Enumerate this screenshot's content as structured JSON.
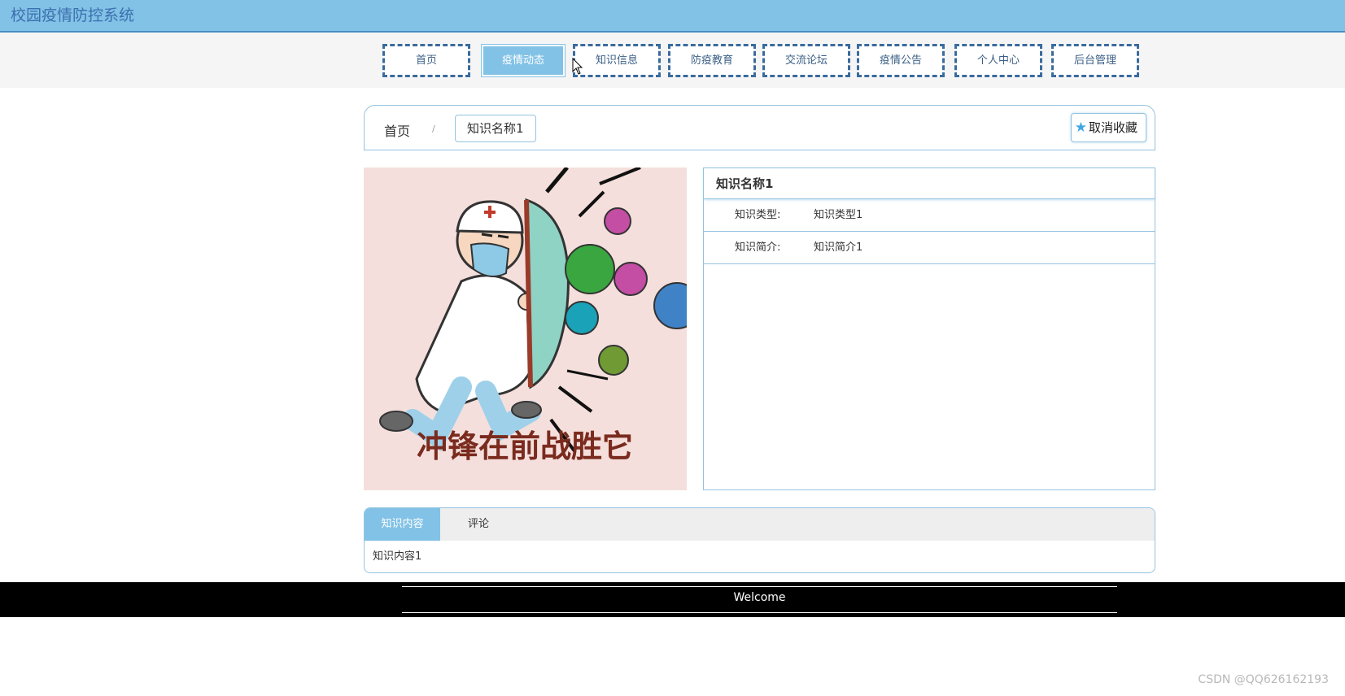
{
  "header": {
    "title": "校园疫情防控系统"
  },
  "nav": {
    "items": [
      {
        "label": "首页",
        "active": false
      },
      {
        "label": "疫情动态",
        "active": true
      },
      {
        "label": "知识信息",
        "active": false
      },
      {
        "label": "防疫教育",
        "active": false
      },
      {
        "label": "交流论坛",
        "active": false
      },
      {
        "label": "疫情公告",
        "active": false
      },
      {
        "label": "个人中心",
        "active": false
      },
      {
        "label": "后台管理",
        "active": false
      }
    ]
  },
  "breadcrumb": {
    "home": "首页",
    "separator": "/",
    "current": "知识名称1",
    "favorite_button": "取消收藏"
  },
  "poster": {
    "caption": "冲锋在前战胜它"
  },
  "detail": {
    "title": "知识名称1",
    "rows": [
      {
        "label": "知识类型:",
        "value": "知识类型1"
      },
      {
        "label": "知识简介:",
        "value": "知识简介1"
      }
    ]
  },
  "tabs": {
    "items": [
      {
        "label": "知识内容",
        "active": true
      },
      {
        "label": "评论",
        "active": false
      }
    ],
    "content": "知识内容1"
  },
  "footer": {
    "text": "Welcome"
  },
  "watermark": "CSDN @QQ626162193",
  "colors": {
    "accent": "#82c2e6",
    "nav_border": "#3a6b9d",
    "panel_border": "#94c3df",
    "title_text": "#3c6fb0"
  }
}
